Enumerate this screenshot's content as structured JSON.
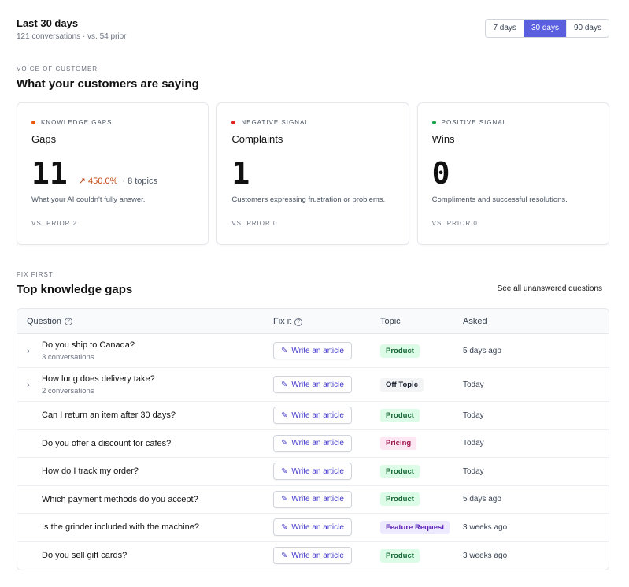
{
  "header": {
    "title": "Last 30 days",
    "subtitle": "121 conversations · vs. 54 prior",
    "ranges": [
      {
        "label": "7 days",
        "active": false
      },
      {
        "label": "30 days",
        "active": true
      },
      {
        "label": "90 days",
        "active": false
      }
    ]
  },
  "voice": {
    "eyebrow": "VOICE OF CUSTOMER",
    "title": "What your customers are saying",
    "cards": [
      {
        "tag": "KNOWLEDGE GAPS",
        "dot_color": "#ea580c",
        "title": "Gaps",
        "value": "11",
        "delta": "450.0%",
        "topics": "· 8 topics",
        "desc": "What your AI couldn't fully answer.",
        "prior": "VS. PRIOR 2"
      },
      {
        "tag": "NEGATIVE SIGNAL",
        "dot_color": "#dc2626",
        "title": "Complaints",
        "value": "1",
        "delta": "",
        "topics": "",
        "desc": "Customers expressing frustration or problems.",
        "prior": "VS. PRIOR 0"
      },
      {
        "tag": "POSITIVE SIGNAL",
        "dot_color": "#16a34a",
        "title": "Wins",
        "value": "0",
        "delta": "",
        "topics": "",
        "desc": "Compliments and successful resolutions.",
        "prior": "VS. PRIOR 0"
      }
    ]
  },
  "gaps": {
    "eyebrow": "FIX FIRST",
    "title": "Top knowledge gaps",
    "see_all": "See all unanswered questions",
    "columns": {
      "question": "Question",
      "fix": "Fix it",
      "topic": "Topic",
      "asked": "Asked"
    },
    "action_label": "Write an article",
    "rows": [
      {
        "question": "Do you ship to Canada?",
        "sub": "3 conversations",
        "expandable": true,
        "topic": "Product",
        "asked": "5 days ago"
      },
      {
        "question": "How long does delivery take?",
        "sub": "2 conversations",
        "expandable": true,
        "topic": "Off Topic",
        "asked": "Today"
      },
      {
        "question": "Can I return an item after 30 days?",
        "sub": "",
        "expandable": false,
        "topic": "Product",
        "asked": "Today"
      },
      {
        "question": "Do you offer a discount for cafes?",
        "sub": "",
        "expandable": false,
        "topic": "Pricing",
        "asked": "Today"
      },
      {
        "question": "How do I track my order?",
        "sub": "",
        "expandable": false,
        "topic": "Product",
        "asked": "Today"
      },
      {
        "question": "Which payment methods do you accept?",
        "sub": "",
        "expandable": false,
        "topic": "Product",
        "asked": "5 days ago"
      },
      {
        "question": "Is the grinder included with the machine?",
        "sub": "",
        "expandable": false,
        "topic": "Feature Request",
        "asked": "3 weeks ago"
      },
      {
        "question": "Do you sell gift cards?",
        "sub": "",
        "expandable": false,
        "topic": "Product",
        "asked": "3 weeks ago"
      }
    ],
    "topic_colors": {
      "Product": {
        "bg": "#dcfce7",
        "fg": "#166534"
      },
      "Off Topic": {
        "bg": "#f3f4f6",
        "fg": "#111827"
      },
      "Pricing": {
        "bg": "#fce7f3",
        "fg": "#9d174d"
      },
      "Feature Request": {
        "bg": "#ede9fe",
        "fg": "#5b21b6"
      }
    }
  }
}
